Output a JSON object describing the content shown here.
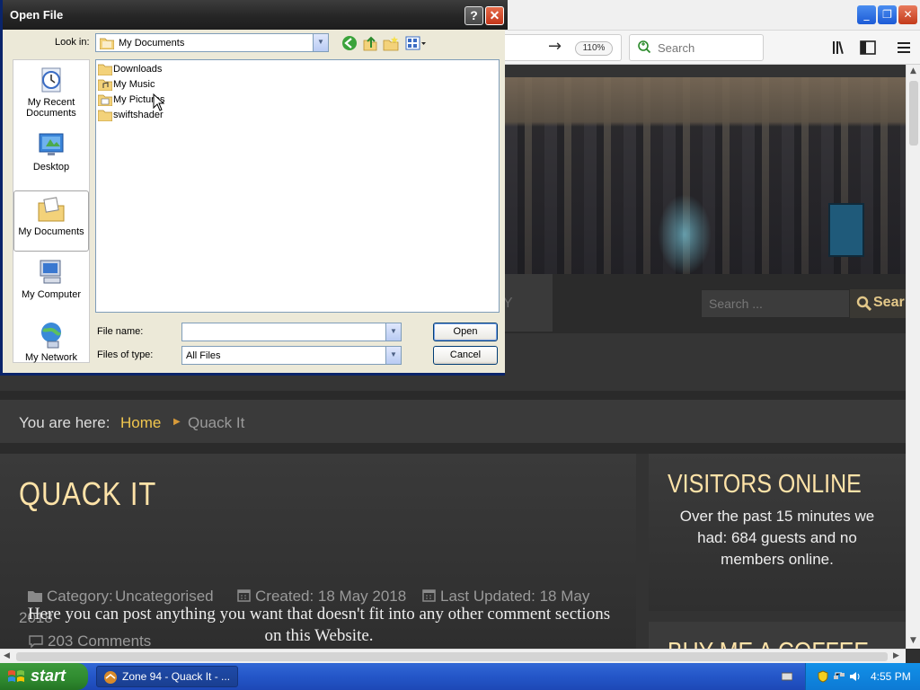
{
  "browser": {
    "zoom": "110%",
    "search_placeholder": "Search"
  },
  "page": {
    "site_search_placeholder": "Search ...",
    "site_search_button": "Sear",
    "nav_tab_partial": "Y",
    "breadcrumb": {
      "label": "You are here:",
      "home": "Home",
      "current": "Quack It"
    },
    "article": {
      "title": "QUACK IT",
      "category_label": "Category:",
      "category_value": "Uncategorised",
      "created": "Created: 18 May 2018",
      "updated": "Last Updated: 18 May",
      "updated_year": "2018",
      "comments": "203 Comments",
      "body": "Here you can post anything you want that doesn't fit into any other comment sections on this Website."
    },
    "sidebar": {
      "visitors_title": "VISITORS ONLINE",
      "visitors_body": "Over the past 15 minutes we had: 684 guests and no members online.",
      "coffee_title": "BUY ME A COFFEE"
    }
  },
  "dialog": {
    "title": "Open File",
    "help": "?",
    "look_in_label": "Look in:",
    "look_in_value": "My Documents",
    "places": [
      "My Recent Documents",
      "Desktop",
      "My Documents",
      "My Computer",
      "My Network"
    ],
    "files": [
      "Downloads",
      "My Music",
      "My Pictures",
      "swiftshader"
    ],
    "file_name_label": "File name:",
    "file_name_value": "",
    "files_of_type_label": "Files of type:",
    "files_of_type_value": "All Files",
    "open_button": "Open",
    "cancel_button": "Cancel"
  },
  "taskbar": {
    "start": "start",
    "task": "Zone 94 - Quack It - ...",
    "clock": "4:55 PM"
  },
  "colors": {
    "accent_gold": "#f0c64e",
    "heading_cream": "#ffe3a8",
    "xp_blue": "#2456c8",
    "xp_green": "#2f8a2f"
  }
}
